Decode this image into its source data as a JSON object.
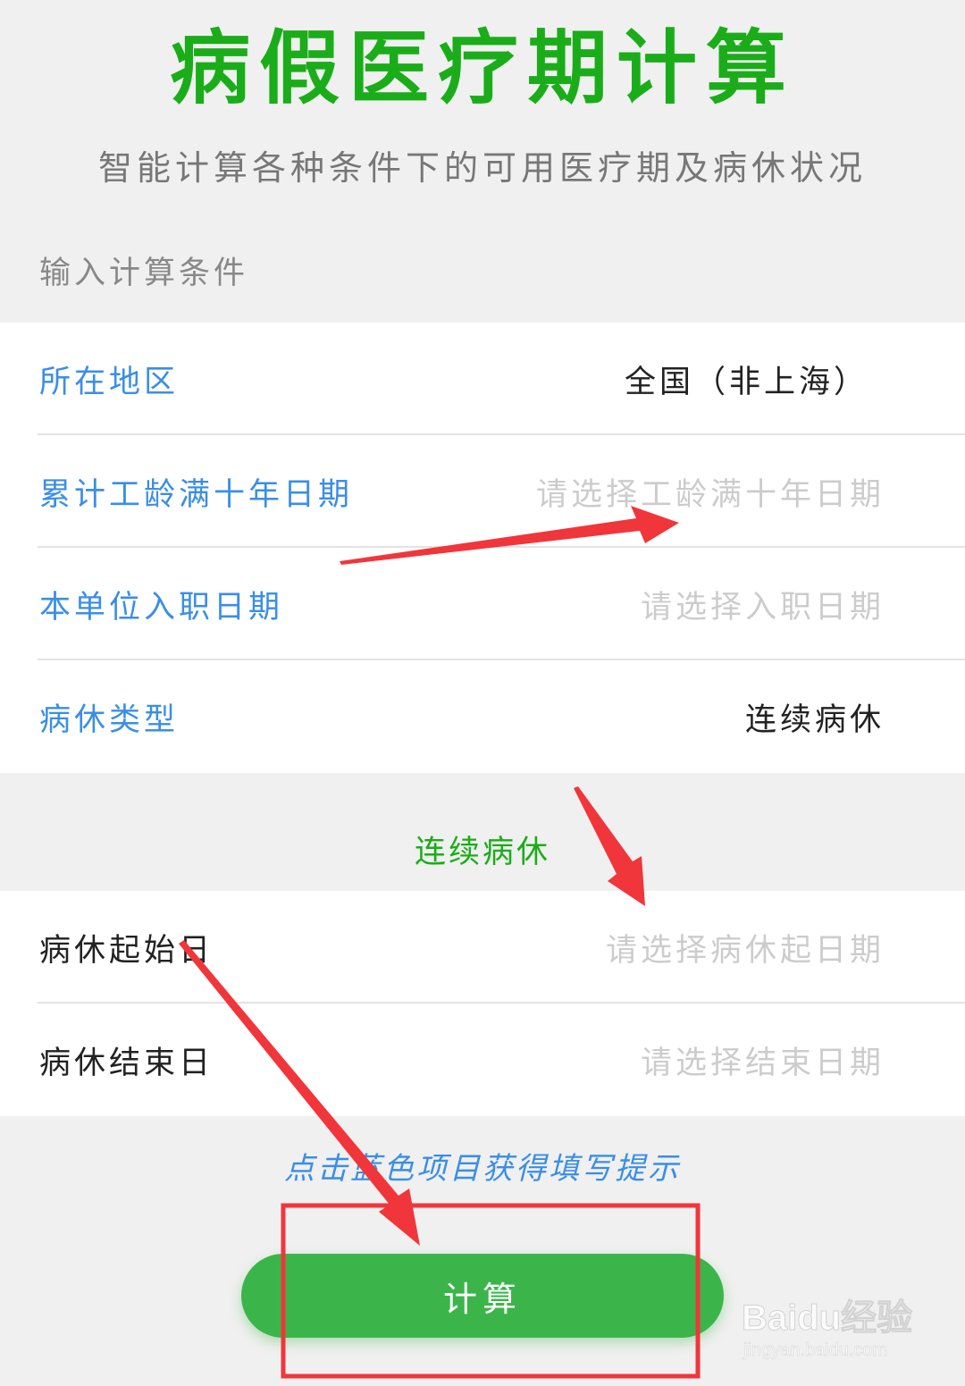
{
  "header": {
    "title": "病假医疗期计算",
    "subtitle": "智能计算各种条件下的可用医疗期及病休状况"
  },
  "input_section": {
    "label": "输入计算条件",
    "rows": [
      {
        "label": "所在地区",
        "value": "全国（非上海）",
        "is_placeholder": false
      },
      {
        "label": "累计工龄满十年日期",
        "value": "请选择工龄满十年日期",
        "is_placeholder": true
      },
      {
        "label": "本单位入职日期",
        "value": "请选择入职日期",
        "is_placeholder": true
      },
      {
        "label": "病休类型",
        "value": "连续病休",
        "is_placeholder": false
      }
    ]
  },
  "leave_section": {
    "title": "连续病休",
    "rows": [
      {
        "label": "病休起始日",
        "value": "请选择病休起日期",
        "is_placeholder": true
      },
      {
        "label": "病休结束日",
        "value": "请选择结束日期",
        "is_placeholder": true
      }
    ]
  },
  "hint": "点击蓝色项目获得填写提示",
  "calculate_button": "计算",
  "watermark": {
    "brand": "Baidu经验",
    "url": "jingyan.baidu.com"
  },
  "colors": {
    "title_green": "#1aad19",
    "subtitle_gray": "#777777",
    "label_blue": "#3a8ee6",
    "value_dark": "#222222",
    "placeholder_gray": "#cccccc",
    "button_green": "#3bb54a",
    "annotation_red": "#f0363a"
  }
}
